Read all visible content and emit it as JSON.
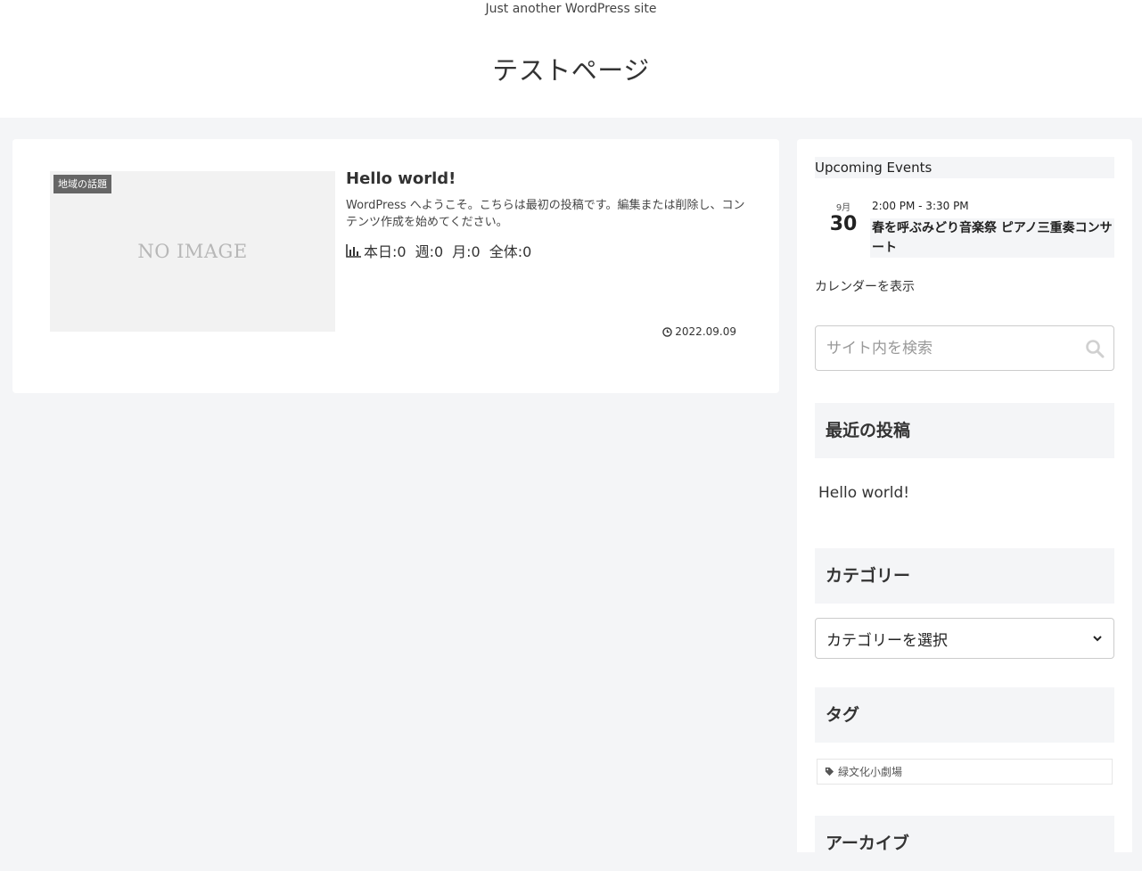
{
  "header": {
    "tagline": "Just another WordPress site",
    "site_title": "テストページ"
  },
  "post": {
    "thumbnail_text": "NO IMAGE",
    "category_label": "地域の話題",
    "title": "Hello world!",
    "excerpt": "WordPress へようこそ。こちらは最初の投稿です。編集または削除し、コンテンツ作成を始めてください。",
    "views": {
      "today": "本日:0",
      "week": "週:0",
      "month": "月:0",
      "total": "全体:0"
    },
    "date": "2022.09.09"
  },
  "sidebar": {
    "events": {
      "heading": "Upcoming Events",
      "month": "9月",
      "day": "30",
      "time": "2:00 PM - 3:30 PM",
      "title": "春を呼ぶみどり音楽祭 ピアノ三重奏コンサート",
      "calendar_link": "カレンダーを表示"
    },
    "search": {
      "placeholder": "サイト内を検索"
    },
    "recent_posts": {
      "heading": "最近の投稿",
      "items": [
        "Hello world!"
      ]
    },
    "categories": {
      "heading": "カテゴリー",
      "selected": "カテゴリーを選択"
    },
    "tags": {
      "heading": "タグ",
      "items": [
        "緑文化小劇場"
      ]
    },
    "archives": {
      "heading": "アーカイブ"
    }
  }
}
